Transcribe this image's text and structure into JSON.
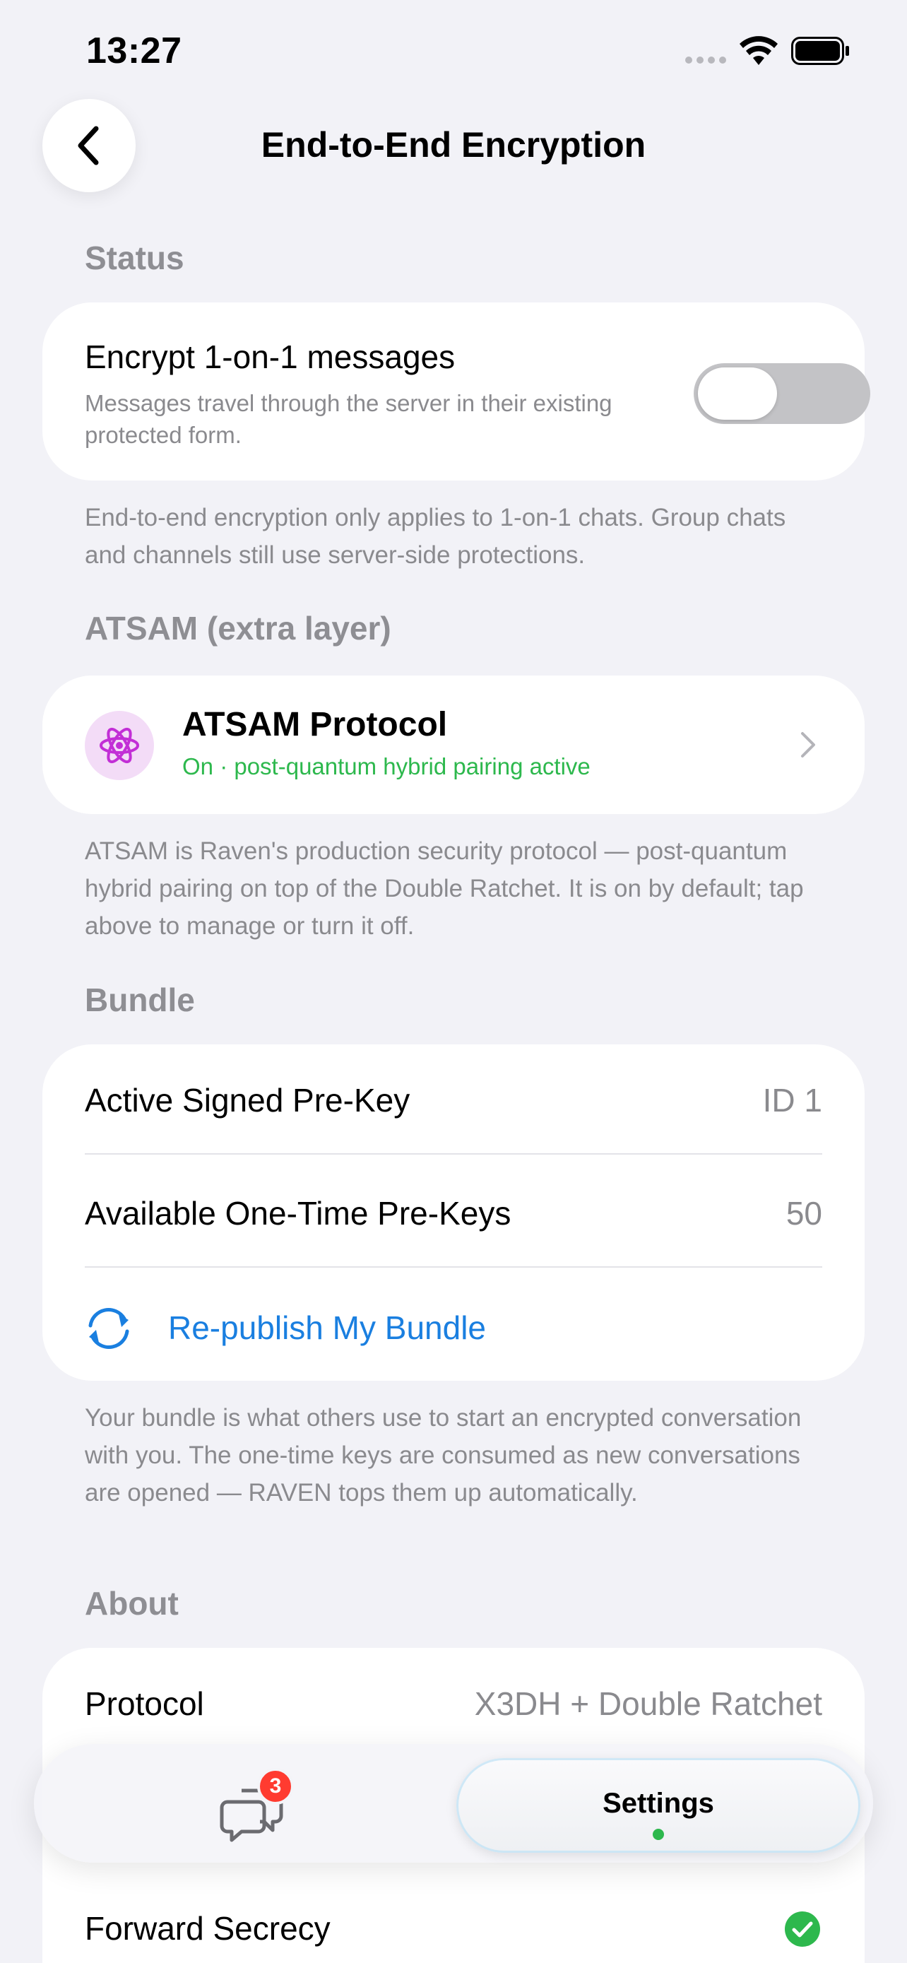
{
  "status_bar": {
    "time": "13:27",
    "icons": [
      "signal-dots-icon",
      "wifi-icon",
      "battery-icon"
    ]
  },
  "nav": {
    "title": "End-to-End Encryption",
    "back_icon": "chevron-left-icon"
  },
  "status_section": {
    "header": "Status",
    "toggle_title": "Encrypt 1-on-1 messages",
    "toggle_subtitle": "Messages travel through the server in their existing protected form.",
    "toggle_on": false,
    "footnote": "End-to-end encryption only applies to 1-on-1 chats. Group chats and channels still use server-side protections."
  },
  "atsam_section": {
    "header": "ATSAM (extra layer)",
    "title": "ATSAM Protocol",
    "subtitle": "On · post-quantum hybrid pairing active",
    "icon": "atom-icon",
    "footnote": "ATSAM is Raven's production security protocol — post-quantum hybrid pairing on top of the Double Ratchet. It is on by default; tap above to manage or turn it off."
  },
  "bundle_section": {
    "header": "Bundle",
    "rows": [
      {
        "label": "Active Signed Pre-Key",
        "value": "ID 1"
      },
      {
        "label": "Available One-Time Pre-Keys",
        "value": "50"
      }
    ],
    "action_label": "Re-publish My Bundle",
    "footnote": "Your bundle is what others use to start an encrypted conversation with you. The one-time keys are consumed as new conversations are opened — RAVEN tops them up automatically."
  },
  "about_section": {
    "header": "About",
    "rows": [
      {
        "label": "Protocol",
        "value": "X3DH + Double Ratchet"
      },
      {
        "label": "Forward Secrecy",
        "value": ""
      }
    ]
  },
  "tab_bar": {
    "chats_badge": "3",
    "settings_label": "Settings"
  },
  "colors": {
    "accent_blue": "#1a7fe0",
    "success_green": "#2db84d",
    "badge_red": "#ff3b30",
    "atsam_purple": "#c22fd6",
    "background": "#f2f2f7"
  }
}
